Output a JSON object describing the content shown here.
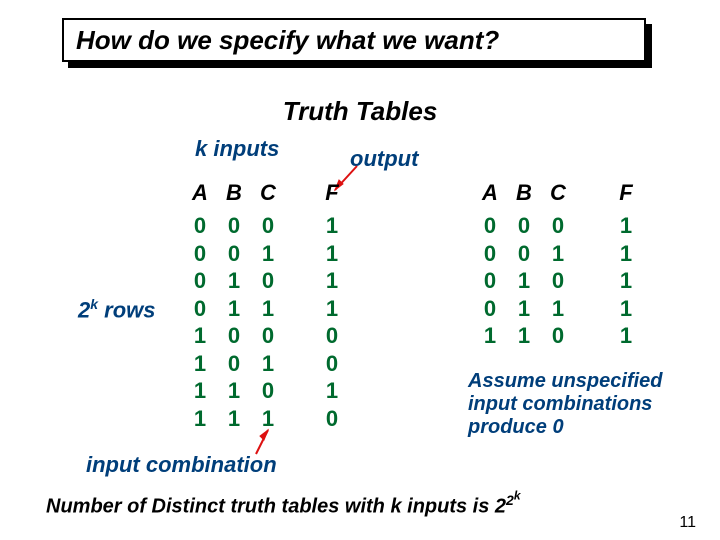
{
  "title": "How do we specify what we want?",
  "subtitle": "Truth Tables",
  "labels": {
    "k_inputs": "k inputs",
    "output": "output",
    "rows_prefix": "2",
    "rows_sup": "k",
    "rows_suffix": " rows",
    "input_combination": "input combination",
    "assume": "Assume unspecified input combinations produce 0"
  },
  "left_table": {
    "headers": [
      "A",
      "B",
      "C",
      "F"
    ],
    "rows": [
      [
        "0",
        "0",
        "0",
        "1"
      ],
      [
        "0",
        "0",
        "1",
        "1"
      ],
      [
        "0",
        "1",
        "0",
        "1"
      ],
      [
        "0",
        "1",
        "1",
        "1"
      ],
      [
        "1",
        "0",
        "0",
        "0"
      ],
      [
        "1",
        "0",
        "1",
        "0"
      ],
      [
        "1",
        "1",
        "0",
        "1"
      ],
      [
        "1",
        "1",
        "1",
        "0"
      ]
    ]
  },
  "right_table": {
    "headers": [
      "A",
      "B",
      "C",
      "F"
    ],
    "rows": [
      [
        "0",
        "0",
        "0",
        "1"
      ],
      [
        "0",
        "0",
        "1",
        "1"
      ],
      [
        "0",
        "1",
        "0",
        "1"
      ],
      [
        "0",
        "1",
        "1",
        "1"
      ],
      [
        "1",
        "1",
        "0",
        "1"
      ]
    ]
  },
  "bottom_line": {
    "prefix": "Number of Distinct truth tables with ",
    "k": "k",
    "mid": " inputs is 2",
    "sup_outer": "2",
    "sup_inner": "k"
  },
  "page_number": "11",
  "chart_data": {
    "type": "table",
    "title": "Truth Tables",
    "tables": [
      {
        "name": "full",
        "columns": [
          "A",
          "B",
          "C",
          "F"
        ],
        "rows": [
          [
            0,
            0,
            0,
            1
          ],
          [
            0,
            0,
            1,
            1
          ],
          [
            0,
            1,
            0,
            1
          ],
          [
            0,
            1,
            1,
            1
          ],
          [
            1,
            0,
            0,
            0
          ],
          [
            1,
            0,
            1,
            0
          ],
          [
            1,
            1,
            0,
            1
          ],
          [
            1,
            1,
            1,
            0
          ]
        ]
      },
      {
        "name": "ones_only",
        "columns": [
          "A",
          "B",
          "C",
          "F"
        ],
        "rows": [
          [
            0,
            0,
            0,
            1
          ],
          [
            0,
            0,
            1,
            1
          ],
          [
            0,
            1,
            0,
            1
          ],
          [
            0,
            1,
            1,
            1
          ],
          [
            1,
            1,
            0,
            1
          ]
        ],
        "note": "Assume unspecified input combinations produce 0"
      }
    ],
    "formula": "Number of distinct truth tables with k inputs = 2^(2^k)"
  }
}
